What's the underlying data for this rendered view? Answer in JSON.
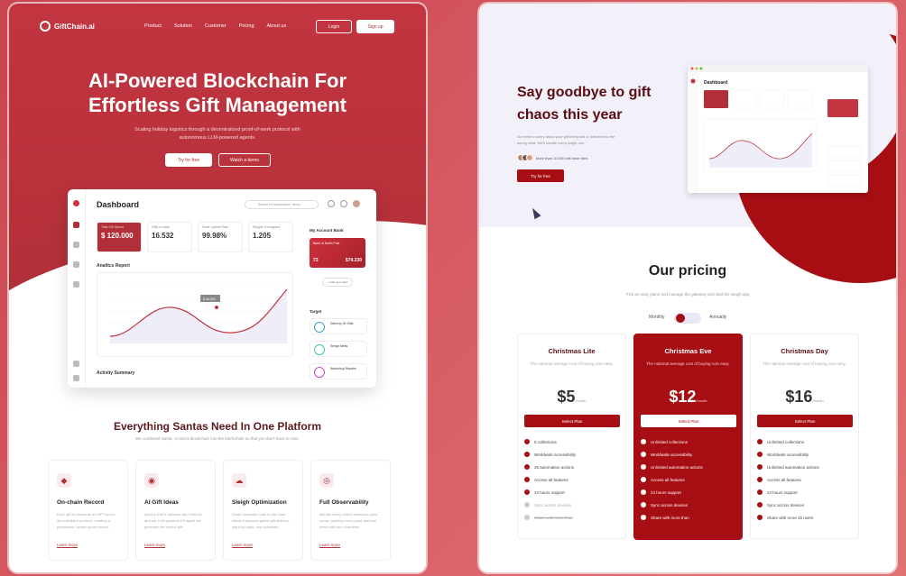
{
  "landing": {
    "logo": "GiftChain.ai",
    "nav": [
      "Product",
      "Solution",
      "Customer",
      "Pricing",
      "About us"
    ],
    "login": "Login",
    "signup": "Sign up",
    "headline": "AI-Powered Blockchain For Effortless Gift Management",
    "subtext": "Scaling holiday logistics through a decentralized proof-of-work protocol with autonomous LLM-powered agents.",
    "cta_primary": "Try for free",
    "cta_secondary": "Watch a demo",
    "dashboard": {
      "title": "Dashboard",
      "search_placeholder": "Search for transactions, items...",
      "stats": [
        {
          "label": "Total Gift Spend",
          "value": "$ 120.000"
        },
        {
          "label": "Gifts in chain",
          "value": "16.532"
        },
        {
          "label": "Node Uptime Rate",
          "value": "99.98%"
        },
        {
          "label": "Sleighs Throughput",
          "value": "1.205"
        }
      ],
      "analytics": "Analitcs Report",
      "activity": "Activity Summary",
      "account_bank": "My Account Bank",
      "card_name": "Bank of North Pole",
      "card_number": "73",
      "card_balance": "$74.230",
      "add_button": "+ Add new Card",
      "target": "Target",
      "targets": [
        "Delivery Of Gifts",
        "Sleigh Ideas",
        "Workshop Repairs"
      ],
      "chart_tag": "$ 46.000"
    },
    "features_title": "Everything Santas Need In One Platform",
    "features_sub": "We combined Santa, AI and a blockchain into the blockchain so that you don't have to care.",
    "features": [
      {
        "icon": "gift-icon",
        "title": "On-chain Record",
        "desc": "Each gift is minted as an NFT on our decentralized protocol, creating a permanent, tamper-proof record.",
        "link": "Learn more"
      },
      {
        "icon": "brain-icon",
        "title": "AI Gift Ideas",
        "desc": "Input a child's behavior and interest, and our LLM-powered Elf agent will generate the perfect gift.",
        "link": "Learn more"
      },
      {
        "icon": "cloud-icon",
        "title": "Sleigh Optimization",
        "desc": "Smart contracts route to the most efficient dynamic global gift delivery, night-by-night, and optimized.",
        "link": "Learn more"
      },
      {
        "icon": "target-icon",
        "title": "Full Observability",
        "desc": "Monitor every child's behaviour year-round, tracking every good and bad deed with zero downtime.",
        "link": "Learn more"
      }
    ]
  },
  "pricing_page": {
    "headline": "Say goodbye to gift chaos this year",
    "subtext": "No need to worry about your gift being lost or delivered to the wrong child. We'll handle every single one.",
    "social_proof": "More than 10.000 elfs have tried",
    "cta": "Try for free",
    "pricing_title": "Our pricing",
    "pricing_sub": "Pick an easy plans and manage the gateway and sled the sleigh app",
    "toggle_monthly": "Monthly",
    "toggle_annually": "Annually",
    "plans": [
      {
        "name": "Christmas Lite",
        "desc": "The national average cost of buying coin easy.",
        "price": "$5",
        "period": "/month",
        "button": "Select Plan",
        "features": [
          {
            "text": "5 collections",
            "on": true
          },
          {
            "text": "Worldwide accessibility",
            "on": true
          },
          {
            "text": "25 automation actions",
            "on": true
          },
          {
            "text": "Access all features",
            "on": true
          },
          {
            "text": "24 hours support",
            "on": true
          },
          {
            "text": "Sync across devices",
            "on": false
          },
          {
            "text": "Share with more than",
            "on": false
          }
        ]
      },
      {
        "name": "Christmas Eve",
        "desc": "The national average cost of buying coin easy.",
        "price": "$12",
        "period": "/month",
        "button": "Select Plan",
        "features": [
          {
            "text": "Unlimited collections",
            "on": true
          },
          {
            "text": "Worldwide accessibility",
            "on": true
          },
          {
            "text": "Unlimited automation actions",
            "on": true
          },
          {
            "text": "Access all features",
            "on": true
          },
          {
            "text": "24 hours support",
            "on": true
          },
          {
            "text": "Sync across devices",
            "on": true
          },
          {
            "text": "Share with more than",
            "on": true
          }
        ]
      },
      {
        "name": "Christmas Day",
        "desc": "The national average cost of buying coin easy.",
        "price": "$16",
        "period": "/month",
        "button": "Select Plan",
        "features": [
          {
            "text": "Unlimited collections",
            "on": true
          },
          {
            "text": "Worldwide accessibility",
            "on": true
          },
          {
            "text": "Unlimited automation actions",
            "on": true
          },
          {
            "text": "Access all features",
            "on": true
          },
          {
            "text": "24 hours support",
            "on": true
          },
          {
            "text": "Sync across devices",
            "on": true
          },
          {
            "text": "Share with more 15 users",
            "on": true
          }
        ]
      }
    ]
  },
  "colors": {
    "brand": "#b02f38",
    "dark_red": "#a70e14",
    "background": "#d65a63"
  }
}
